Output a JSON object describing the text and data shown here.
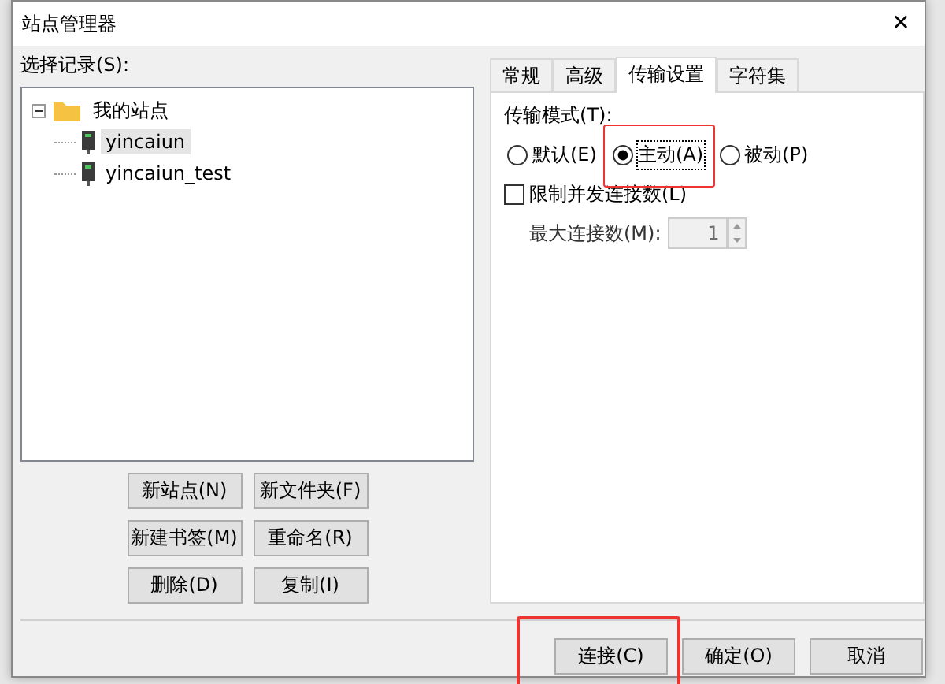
{
  "window": {
    "title": "站点管理器",
    "close": "✕"
  },
  "sites": {
    "label": "选择记录(S):",
    "tree": [
      {
        "label": "我的站点",
        "kind": "folder",
        "expanded": true,
        "selected": false,
        "children": [
          {
            "label": "yincaiun",
            "kind": "site",
            "selected": true
          },
          {
            "label": "yincaiun_test",
            "kind": "site",
            "selected": false
          }
        ]
      }
    ]
  },
  "site_buttons": [
    "新站点(N)",
    "新文件夹(F)",
    "新建书签(M)",
    "重命名(R)",
    "删除(D)",
    "复制(I)"
  ],
  "tabs": [
    {
      "label": "常规",
      "selected": false
    },
    {
      "label": "高级",
      "selected": false
    },
    {
      "label": "传输设置",
      "selected": true
    },
    {
      "label": "字符集",
      "selected": false
    }
  ],
  "transfer_mode": {
    "label": "传输模式(T):",
    "options": [
      {
        "label": "默认(E)",
        "selected": false,
        "highlighted": false
      },
      {
        "label": "主动(A)",
        "selected": true,
        "highlighted": true
      },
      {
        "label": "被动(P)",
        "selected": false,
        "highlighted": false
      }
    ]
  },
  "limit": {
    "label": "限制并发连接数(L)",
    "checked": false
  },
  "max_connections": {
    "label": "最大连接数(M):",
    "value": "1",
    "disabled": true
  },
  "buttons": [
    {
      "label": "连接(C)",
      "highlighted": true
    },
    {
      "label": "确定(O)",
      "highlighted": false
    },
    {
      "label": "取消",
      "highlighted": false
    }
  ]
}
